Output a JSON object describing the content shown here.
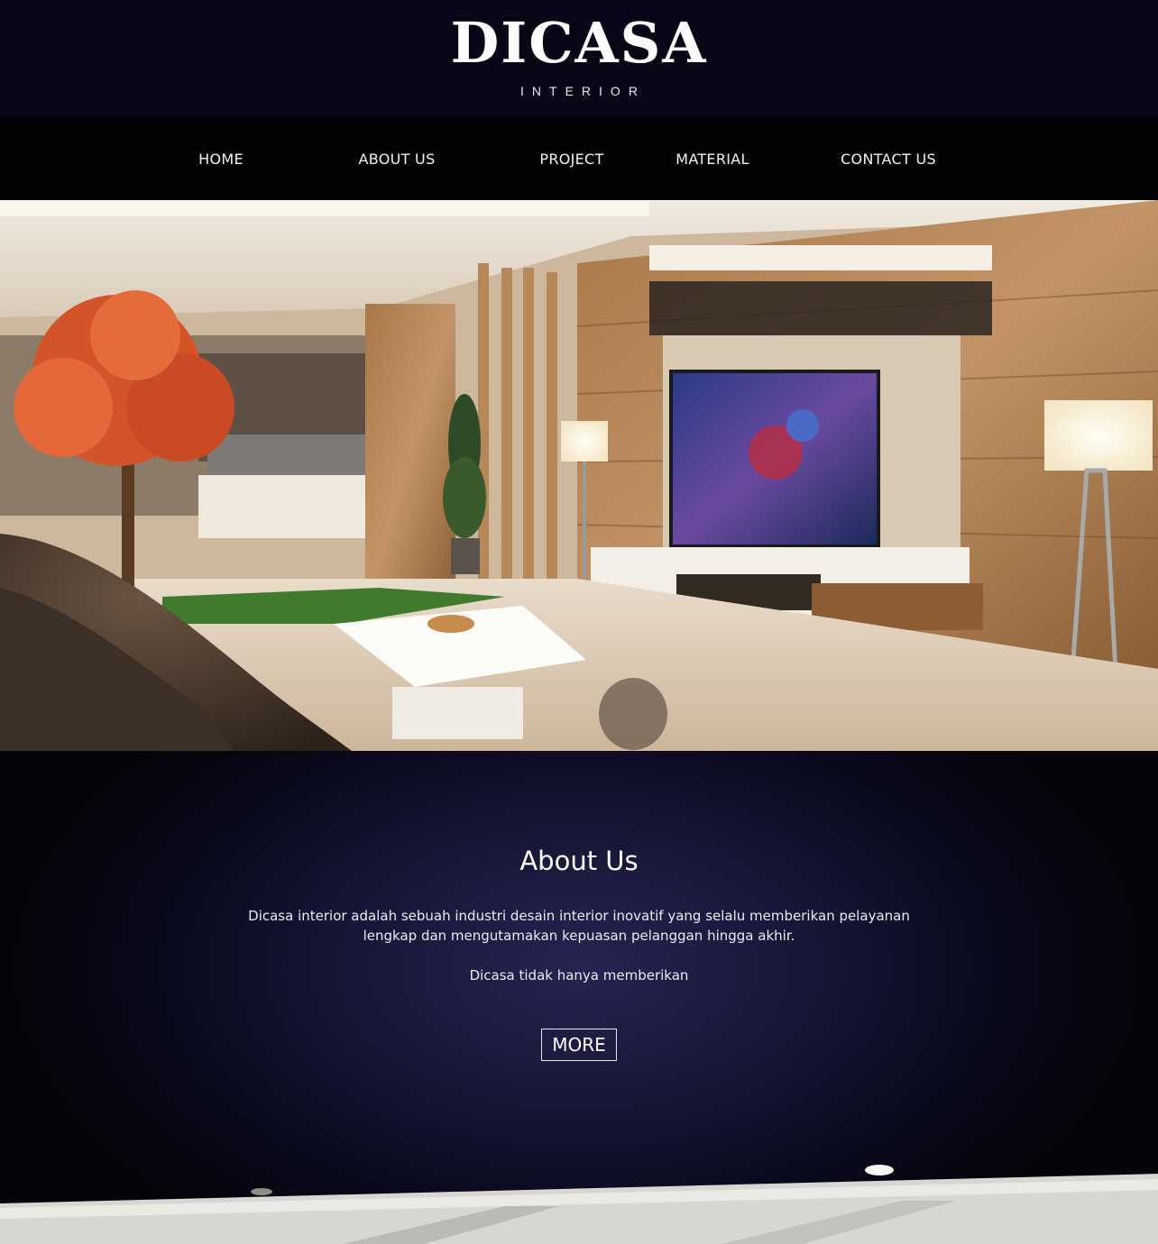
{
  "logo": {
    "wordmark": "DICASA",
    "subtitle": "INTERIOR"
  },
  "nav": {
    "items": [
      {
        "label": "HOME"
      },
      {
        "label": "ABOUT US"
      },
      {
        "label": "PROJECT"
      },
      {
        "label": "MATERIAL"
      },
      {
        "label": "CONTACT US"
      }
    ]
  },
  "about": {
    "title": "About Us",
    "paragraph1": "Dicasa interior adalah sebuah industri desain interior inovatif yang selalu memberikan pelayanan lengkap dan mengutamakan kepuasan pelanggan hingga akhir.",
    "paragraph2": "Dicasa tidak hanya memberikan",
    "more_label": "MORE"
  },
  "colors": {
    "header_bg": "#070717",
    "nav_bg": "#030306",
    "about_glow": "#262452",
    "text": "#ffffff"
  }
}
